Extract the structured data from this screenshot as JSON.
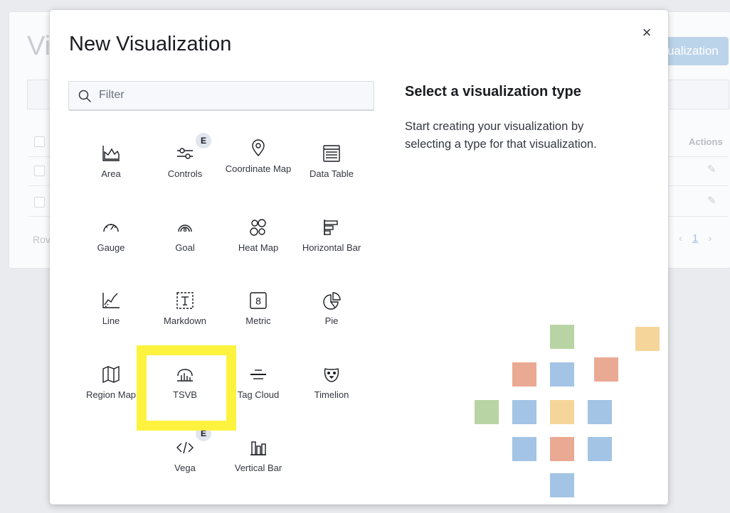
{
  "background": {
    "title_fragment": "Vi",
    "create_button_fragment": "ualization",
    "actions_label": "Actions",
    "rows_label_fragment": "Rov",
    "pager": {
      "prev": "‹",
      "page": "1",
      "next": "›"
    },
    "pencil": "✎"
  },
  "modal": {
    "title": "New Visualization",
    "close_symbol": "×",
    "filter": {
      "placeholder": "Filter",
      "value": ""
    },
    "side_title": "Select a visualization type",
    "side_description": "Start creating your visualization by selecting a type for that visualization.",
    "experimental_badge": "E",
    "types": [
      {
        "label": "Area",
        "icon": "area-chart-icon",
        "experimental": false
      },
      {
        "label": "Controls",
        "icon": "controls-icon",
        "experimental": true
      },
      {
        "label": "Coordinate Map",
        "icon": "map-pin-icon",
        "experimental": false
      },
      {
        "label": "Data Table",
        "icon": "data-table-icon",
        "experimental": false
      },
      {
        "label": "Gauge",
        "icon": "gauge-icon",
        "experimental": false
      },
      {
        "label": "Goal",
        "icon": "goal-icon",
        "experimental": false
      },
      {
        "label": "Heat Map",
        "icon": "heat-map-icon",
        "experimental": false
      },
      {
        "label": "Horizontal Bar",
        "icon": "horizontal-bar-icon",
        "experimental": false
      },
      {
        "label": "Line",
        "icon": "line-chart-icon",
        "experimental": false
      },
      {
        "label": "Markdown",
        "icon": "markdown-icon",
        "experimental": false
      },
      {
        "label": "Metric",
        "icon": "metric-icon",
        "experimental": false
      },
      {
        "label": "Pie",
        "icon": "pie-chart-icon",
        "experimental": false
      },
      {
        "label": "Region Map",
        "icon": "region-map-icon",
        "experimental": false
      },
      {
        "label": "TSVB",
        "icon": "tsvb-icon",
        "experimental": false
      },
      {
        "label": "Tag Cloud",
        "icon": "tag-cloud-icon",
        "experimental": false
      },
      {
        "label": "Timelion",
        "icon": "timelion-icon",
        "experimental": false
      },
      {
        "label": "Vega",
        "icon": "vega-code-icon",
        "experimental": true
      },
      {
        "label": "Vertical Bar",
        "icon": "vertical-bar-icon",
        "experimental": false
      }
    ],
    "highlighted_type": "TSVB"
  },
  "colors": {
    "highlight": "#fdf33e",
    "illustration_green": "#b8d4a4",
    "illustration_red": "#eaa993",
    "illustration_blue": "#a3c4e4",
    "illustration_yellow": "#f6d59a"
  }
}
